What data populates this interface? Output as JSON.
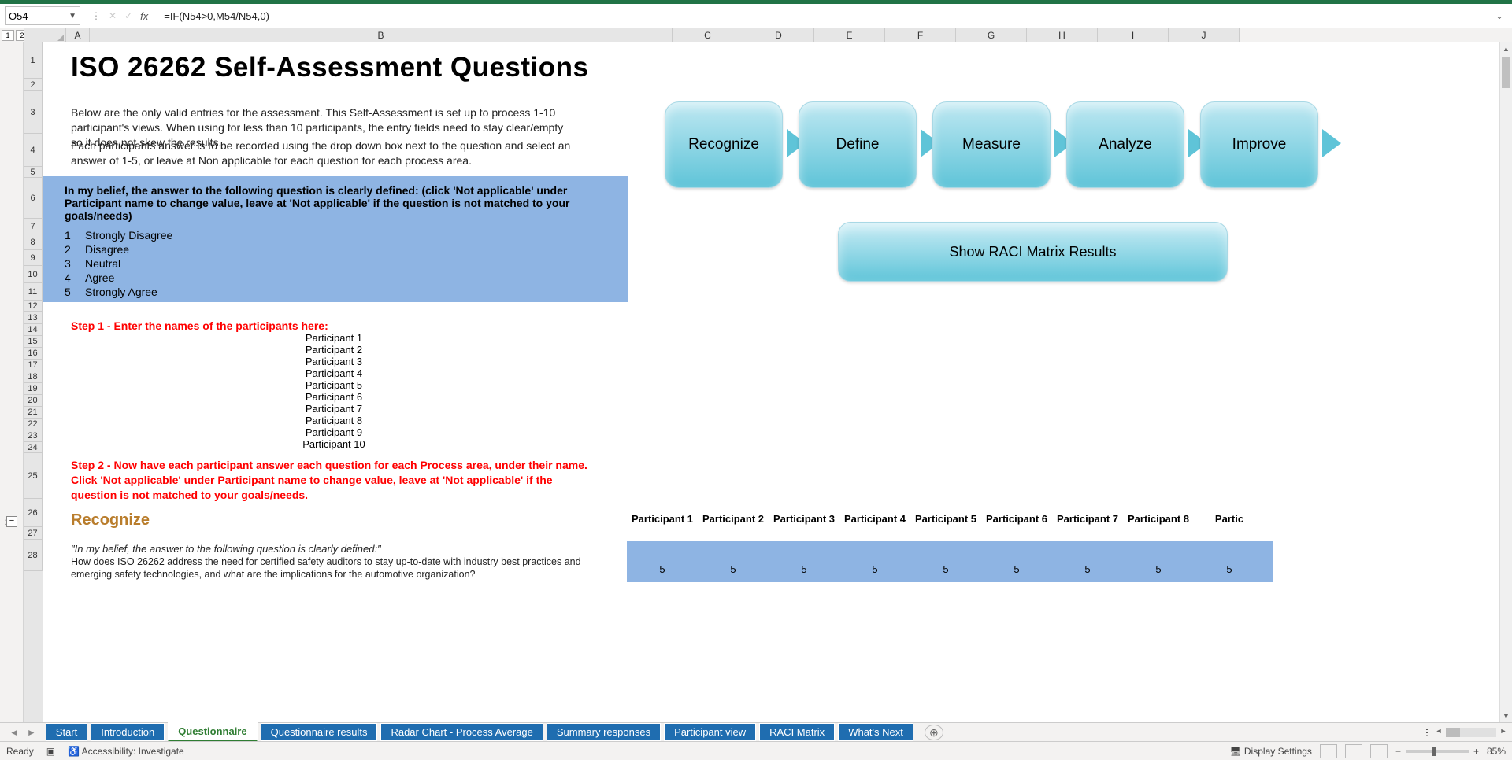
{
  "name_box": "O54",
  "formula": "=IF(N54>0,M54/N54,0)",
  "outline_levels": [
    "1",
    "2"
  ],
  "columns": [
    "A",
    "B",
    "C",
    "D",
    "E",
    "F",
    "G",
    "H",
    "I",
    "J"
  ],
  "row_nums": [
    "1",
    "2",
    "3",
    "4",
    "5",
    "6",
    "7",
    "8",
    "9",
    "10",
    "11",
    "12",
    "13",
    "14",
    "15",
    "16",
    "17",
    "18",
    "19",
    "20",
    "21",
    "22",
    "23",
    "24",
    "25",
    "26",
    "27",
    "28"
  ],
  "title": "ISO 26262 Self-Assessment Questions",
  "intro1": "Below are the only valid entries for the assessment. This Self-Assessment is set up to process 1-10 participant's views. When using for less than 10 participants, the entry fields need to stay clear/empty so it does not skew the results.",
  "intro2": "Each participants answer is to be recorded using the drop down box next to the question and select an answer of 1-5, or leave at Non applicable for each question for each process area.",
  "scale_header": "In my belief, the answer to the following question is clearly defined: (click 'Not applicable' under Participant name to change value, leave at 'Not applicable' if the question is not matched to your goals/needs)",
  "scale": [
    {
      "n": "1",
      "l": "Strongly Disagree"
    },
    {
      "n": "2",
      "l": "Disagree"
    },
    {
      "n": "3",
      "l": "Neutral"
    },
    {
      "n": "4",
      "l": "Agree"
    },
    {
      "n": "5",
      "l": "Strongly Agree"
    }
  ],
  "step1": "Step 1 - Enter the names of the participants here:",
  "participants": [
    "Participant 1",
    "Participant 2",
    "Participant 3",
    "Participant 4",
    "Participant 5",
    "Participant 6",
    "Participant 7",
    "Participant 8",
    "Participant 9",
    "Participant 10"
  ],
  "step2": "Step 2 - Now have each participant answer each question for each Process area, under their name. Click 'Not applicable' under Participant name to change value, leave at 'Not applicable' if the question is not matched to your goals/needs.",
  "outline_1": "1",
  "recognize": "Recognize",
  "part_headers": [
    "Participant 1",
    "Participant 2",
    "Participant 3",
    "Participant 4",
    "Participant 5",
    "Participant 6",
    "Participant 7",
    "Participant 8",
    "Partic"
  ],
  "italic_line": "\"In my belief, the answer to the following question is clearly defined:\"",
  "q_text": "How does ISO 26262 address the need for certified safety auditors to stay up-to-date with industry best practices and emerging safety technologies, and what are the implications for the automotive organization?",
  "fives": [
    "5",
    "5",
    "5",
    "5",
    "5",
    "5",
    "5",
    "5",
    "5"
  ],
  "process_buttons": [
    "Recognize",
    "Define",
    "Measure",
    "Analyze",
    "Improve"
  ],
  "raci_label": "Show RACI Matrix Results",
  "sheet_tabs": [
    "Start",
    "Introduction",
    "Questionnaire",
    "Questionnaire results",
    "Radar Chart - Process Average",
    "Summary responses",
    "Participant view",
    "RACI Matrix",
    "What's Next"
  ],
  "active_tab_index": 2,
  "status_ready": "Ready",
  "accessibility": "Accessibility: Investigate",
  "display_settings": "Display Settings",
  "zoom": "85%"
}
